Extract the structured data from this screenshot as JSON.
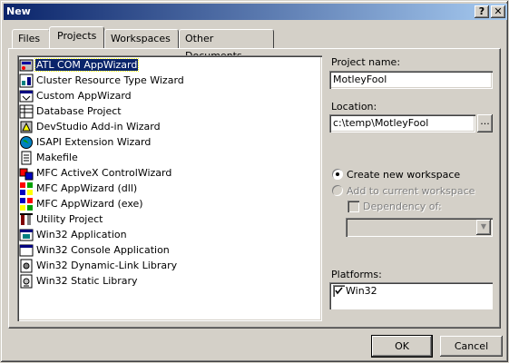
{
  "window": {
    "title": "New",
    "help_btn": "?",
    "close_btn": "✕"
  },
  "tabs": [
    {
      "label": "Files",
      "active": false
    },
    {
      "label": "Projects",
      "active": true
    },
    {
      "label": "Workspaces",
      "active": false
    },
    {
      "label": "Other Documents",
      "active": false
    }
  ],
  "projects": {
    "items": [
      {
        "label": "ATL COM AppWizard",
        "icon": "atl-com-icon",
        "selected": true
      },
      {
        "label": "Cluster Resource Type Wizard",
        "icon": "cluster-icon"
      },
      {
        "label": "Custom AppWizard",
        "icon": "custom-wizard-icon"
      },
      {
        "label": "Database Project",
        "icon": "database-icon"
      },
      {
        "label": "DevStudio Add-in Wizard",
        "icon": "devstudio-addin-icon"
      },
      {
        "label": "ISAPI Extension Wizard",
        "icon": "isapi-globe-icon"
      },
      {
        "label": "Makefile",
        "icon": "makefile-icon"
      },
      {
        "label": "MFC ActiveX ControlWizard",
        "icon": "mfc-activex-icon"
      },
      {
        "label": "MFC AppWizard (dll)",
        "icon": "mfc-dll-icon"
      },
      {
        "label": "MFC AppWizard (exe)",
        "icon": "mfc-exe-icon"
      },
      {
        "label": "Utility Project",
        "icon": "utility-icon"
      },
      {
        "label": "Win32 Application",
        "icon": "win32-app-icon"
      },
      {
        "label": "Win32 Console Application",
        "icon": "console-icon"
      },
      {
        "label": "Win32 Dynamic-Link Library",
        "icon": "dll-icon"
      },
      {
        "label": "Win32 Static Library",
        "icon": "static-lib-icon"
      }
    ]
  },
  "form": {
    "project_name_label": "Project name:",
    "project_name_value": "MotleyFool",
    "location_label": "Location:",
    "location_value": "c:\\temp\\MotleyFool",
    "browse_label": "...",
    "create_new_label": "Create new workspace",
    "add_current_label": "Add to current workspace",
    "dependency_label": "Dependency of:",
    "platforms_label": "Platforms:",
    "platform_value": "Win32"
  },
  "buttons": {
    "ok": "OK",
    "cancel": "Cancel"
  }
}
